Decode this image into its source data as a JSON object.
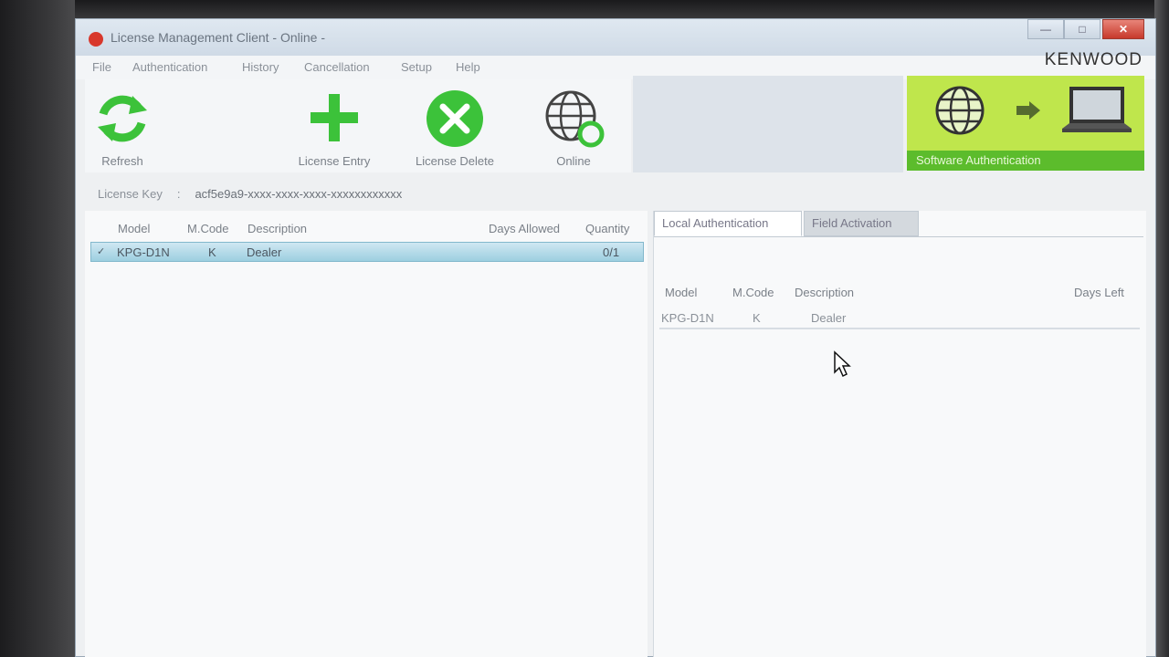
{
  "window": {
    "title": "License Management Client - Online -"
  },
  "titlebar_buttons": {
    "minimize": "—",
    "maximize": "□",
    "close": "✕"
  },
  "menu": [
    "File",
    "Authentication",
    "History",
    "Cancellation",
    "Setup",
    "Help"
  ],
  "brand": "KENWOOD",
  "toolbar": {
    "refresh": "Refresh",
    "license_entry": "License Entry",
    "license_delete": "License Delete",
    "online": "Online"
  },
  "software_auth": {
    "label": "Software Authentication"
  },
  "license_key": {
    "label": "License Key",
    "separator": ":",
    "value": "acf5e9a9-xxxx-xxxx-xxxx-xxxxxxxxxxxx"
  },
  "left_table": {
    "headers": {
      "model": "Model",
      "mcode": "M.Code",
      "description": "Description",
      "days_allowed": "Days Allowed",
      "quantity": "Quantity"
    },
    "rows": [
      {
        "check": "✓",
        "model": "KPG-D1N",
        "mcode": "K",
        "description": "Dealer",
        "quantity": "0/1"
      }
    ]
  },
  "right_tabs": {
    "local": "Local Authentication",
    "field": "Field Activation"
  },
  "right_table": {
    "headers": {
      "model": "Model",
      "mcode": "M.Code",
      "description": "Description",
      "days_left": "Days Left"
    },
    "rows": [
      {
        "model": "KPG-D1N",
        "mcode": "K",
        "description": "Dealer"
      }
    ]
  },
  "colors": {
    "accent_green": "#3cc23a",
    "auth_panel": "#bfe64c",
    "auth_bar": "#5cbc2c",
    "selection": "#9dcfe0"
  },
  "icons": [
    "refresh-icon",
    "plus-icon",
    "delete-x-icon",
    "globe-online-icon",
    "globe-icon",
    "arrow-right-icon",
    "laptop-icon",
    "mouse-cursor-icon"
  ]
}
